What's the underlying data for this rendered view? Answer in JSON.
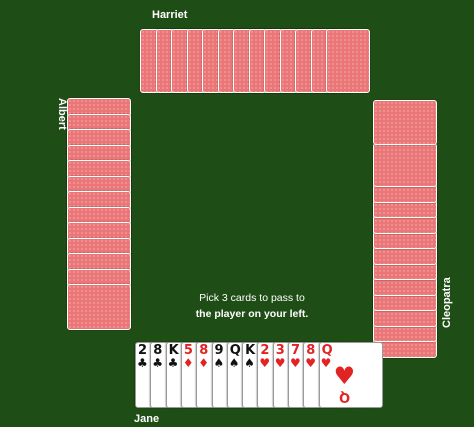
{
  "players": {
    "top": "Harriet",
    "left": "Albert",
    "right": "Cleopatra",
    "bottom": "Jane"
  },
  "opponents": {
    "top_count": 13,
    "left_count": 13,
    "right_count": 13
  },
  "hint": {
    "line1": "Pick 3 cards to pass to",
    "line2": "the player on your left."
  },
  "hand": [
    {
      "rank": "2",
      "suit": "♣",
      "suit_name": "clubs",
      "color": "black"
    },
    {
      "rank": "8",
      "suit": "♣",
      "suit_name": "clubs",
      "color": "black"
    },
    {
      "rank": "K",
      "suit": "♣",
      "suit_name": "clubs",
      "color": "black"
    },
    {
      "rank": "5",
      "suit": "♦",
      "suit_name": "diamonds",
      "color": "red"
    },
    {
      "rank": "8",
      "suit": "♦",
      "suit_name": "diamonds",
      "color": "red"
    },
    {
      "rank": "9",
      "suit": "♠",
      "suit_name": "spades",
      "color": "black"
    },
    {
      "rank": "Q",
      "suit": "♠",
      "suit_name": "spades",
      "color": "black"
    },
    {
      "rank": "K",
      "suit": "♠",
      "suit_name": "spades",
      "color": "black"
    },
    {
      "rank": "2",
      "suit": "♥",
      "suit_name": "hearts",
      "color": "red"
    },
    {
      "rank": "3",
      "suit": "♥",
      "suit_name": "hearts",
      "color": "red"
    },
    {
      "rank": "7",
      "suit": "♥",
      "suit_name": "hearts",
      "color": "red"
    },
    {
      "rank": "8",
      "suit": "♥",
      "suit_name": "hearts",
      "color": "red"
    },
    {
      "rank": "Q",
      "suit": "♥",
      "suit_name": "hearts",
      "color": "red"
    }
  ],
  "colors": {
    "table": "#1f4d16",
    "card_back": "#ea7677",
    "red_suit": "#e22323",
    "black_suit": "#111111"
  }
}
